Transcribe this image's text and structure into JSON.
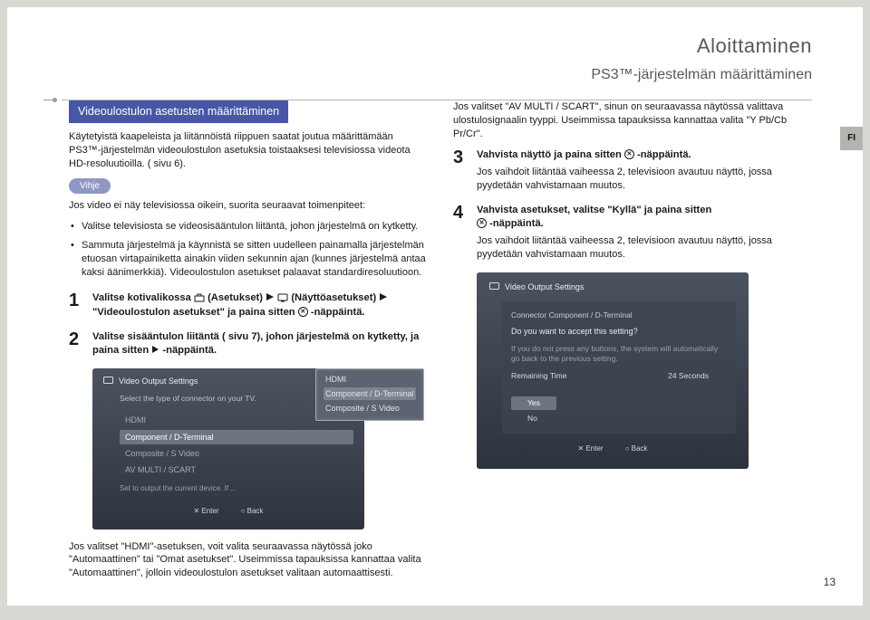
{
  "lang_tab": "FI",
  "header": {
    "title": "Aloittaminen",
    "subtitle": "PS3™-järjestelmän määrittäminen"
  },
  "left": {
    "section_badge": "Videoulostulon asetusten määrittäminen",
    "intro": "Käytetyistä kaapeleista ja liitännöistä riippuen saatat joutua määrittämään PS3™-järjestelmän videoulostulon asetuksia toistaaksesi televisiossa videota HD-resoluutioilla. (  sivu 6).",
    "hint_label": "Vihje",
    "hint_intro": "Jos video ei näy televisiossa oikein, suorita seuraavat toimenpiteet:",
    "bullets": [
      "Valitse televisiosta se videosisääntulon liitäntä, johon järjestelmä on kytketty.",
      "Sammuta järjestelmä ja käynnistä se sitten uudelleen painamalla järjestelmän etuosan virtapainiketta ainakin viiden sekunnin ajan (kunnes järjestelmä antaa kaksi äänimerkkiä). Videoulostulon asetukset palaavat standardiresoluutioon."
    ],
    "step1": {
      "num": "1",
      "a": "Valitse kotivalikossa ",
      "b": " (Asetukset) ",
      "c": " (Näyttöasetukset) ",
      "d": "\"Videoulostulon asetukset\" ja paina sitten ",
      "e": "-näppäintä."
    },
    "step2": {
      "num": "2",
      "a": "Valitse sisääntulon liitäntä (  sivu 7), johon järjestelmä on kytketty, ja paina sitten ",
      "b": "-näppäintä."
    },
    "menu1": {
      "title": "Video Output Settings",
      "subtitle": "Select the type of connector on your TV.",
      "opts": [
        "HDMI",
        "Component / D-Terminal",
        "Composite / S Video",
        "AV MULTI / SCART"
      ],
      "tip": "Set to output the current device. If ...",
      "foot_enter": "✕ Enter",
      "foot_back": "○ Back",
      "zoom": [
        "HDMI",
        "Component / D-Terminal",
        "Composite / S Video"
      ]
    },
    "after_menu": "Jos valitset \"HDMI\"-asetuksen, voit valita seuraavassa näytössä joko \"Automaattinen\" tai \"Omat asetukset\". Useimmissa tapauksissa kannattaa valita \"Automaattinen\", jolloin videoulostulon asetukset valitaan automaattisesti."
  },
  "right": {
    "top_para": "Jos valitset \"AV MULTI / SCART\", sinun on seuraavassa näytössä valittava ulostulosignaalin tyyppi. Useimmissa tapauksissa kannattaa valita \"Y Pb/Cb Pr/Cr\".",
    "step3": {
      "num": "3",
      "a": "Vahvista näyttö ja paina sitten ",
      "b": "-näppäintä.",
      "sub": "Jos vaihdoit liitäntää vaiheessa 2, televisioon avautuu näyttö, jossa pyydetään vahvistamaan muutos."
    },
    "step4": {
      "num": "4",
      "a": "Vahvista asetukset, valitse \"Kyllä\" ja paina sitten ",
      "b": "-näppäintä.",
      "sub": "Jos vaihdoit liitäntää vaiheessa 2, televisioon avautuu näyttö, jossa pyydetään vahvistamaan muutos."
    },
    "menu2": {
      "title": "Video Output Settings",
      "line": "Connector  Component / D-Terminal",
      "prompt": "Do you want to accept this setting?",
      "tiny": "If you do not press any buttons, the system will automatically go back to the previous setting.",
      "remain_label": "Remaining Time",
      "remain_val": "24 Seconds",
      "yes": "Yes",
      "no": "No",
      "foot_enter": "✕ Enter",
      "foot_back": "○ Back"
    }
  },
  "pagenum": "13"
}
